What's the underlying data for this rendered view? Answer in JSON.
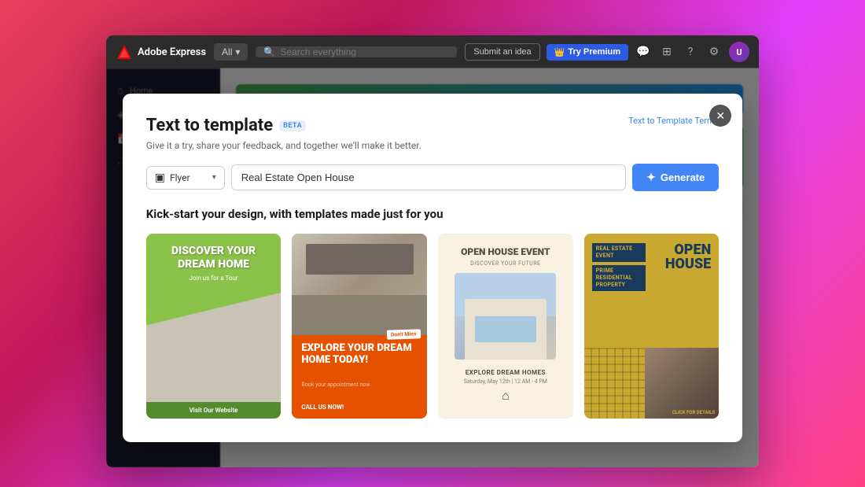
{
  "app": {
    "brand": "Adobe Express",
    "nav": {
      "all_label": "All",
      "search_placeholder": "Search everything",
      "submit_idea": "Submit an idea",
      "try_premium": "Try Premium"
    }
  },
  "modal": {
    "title": "Text to template",
    "beta_label": "BETA",
    "subtitle": "Give it a try, share your feedback, and together we'll make it better.",
    "terms_link": "Text to Template Terms",
    "type_selector": "Flyer",
    "prompt_value": "Real Estate Open House",
    "generate_label": "Generate",
    "kickstart_title": "Kick-start your design, with templates made just for you",
    "close_label": "✕"
  },
  "templates": [
    {
      "id": 1,
      "headline": "DISCOVER YOUR DREAM HOME",
      "sub": "Join us for a Tour",
      "bottom": "Visit Our Website",
      "style": "green"
    },
    {
      "id": 2,
      "headline": "EXPLORE YOUR DREAM HOME TODAY!",
      "sub": "Book your appointment now",
      "cta": "CALL US NOW!",
      "dont_miss": "Don't Miss",
      "style": "orange"
    },
    {
      "id": 3,
      "headline": "OPEN HOUSE EVENT",
      "sub": "DISCOVER YOUR FUTURE",
      "explore": "EXPLORE DREAM HOMES",
      "date": "Saturday, May 12th | 12 AM - 4 PM",
      "style": "beige"
    },
    {
      "id": 4,
      "tag1": "REAL ESTATE EVENT",
      "tag2": "PRIME RESIDENTIAL PROPERTY",
      "tag3": "CLICK FOR DETAILS",
      "title": "OPEN HOUSE",
      "style": "gold"
    }
  ]
}
